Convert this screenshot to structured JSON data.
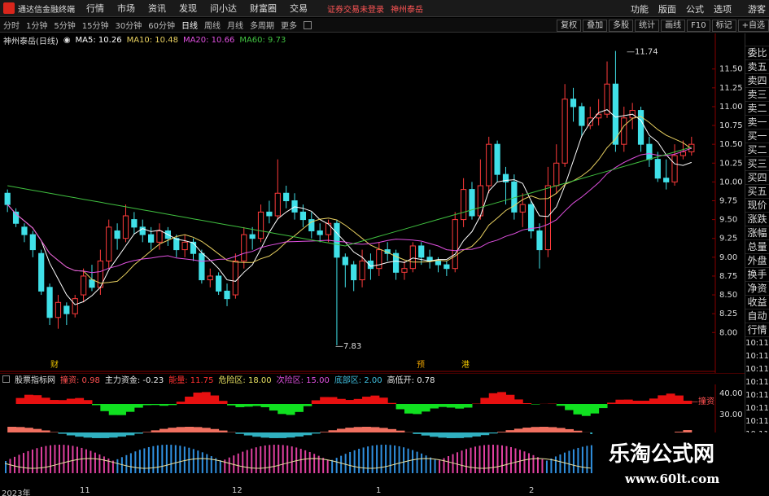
{
  "app": {
    "title": "通达信金融终端",
    "menu": [
      "行情",
      "市场",
      "资讯",
      "发现",
      "问小达",
      "财富圈",
      "交易"
    ],
    "login_notice": "证券交易未登录",
    "stock_name": "神州泰岳",
    "right_menu": [
      "功能",
      "版面",
      "公式",
      "选项"
    ],
    "guest": "游客"
  },
  "periods": [
    "分时",
    "1分钟",
    "5分钟",
    "15分钟",
    "30分钟",
    "60分钟",
    "日线",
    "周线",
    "月线",
    "多周期",
    "更多"
  ],
  "active_period": "日线",
  "toolbar": [
    "复权",
    "叠加",
    "多股",
    "统计",
    "画线",
    "F10",
    "标记",
    "+自选"
  ],
  "ma_legend": {
    "title": "神州泰岳(日线)",
    "ma5": "MA5: 10.26",
    "ma10": "MA10: 10.48",
    "ma20": "MA20: 10.66",
    "ma60": "MA60: 9.73",
    "ma5_color": "#ffffff",
    "ma10_color": "#e8d060",
    "ma20_color": "#e050e0",
    "ma60_color": "#40c040"
  },
  "price_ticks": [
    "11.50",
    "11.25",
    "11.00",
    "10.75",
    "10.50",
    "10.25",
    "10.00",
    "9.75",
    "9.50",
    "9.25",
    "9.00",
    "8.75",
    "8.50",
    "8.25",
    "8.00"
  ],
  "annotations": {
    "high": "11.74",
    "low": "7.83",
    "mark_a": "财",
    "mark_b": "预",
    "mark_c": "港"
  },
  "indicator": {
    "name": "股票指标网",
    "label1": "撞资: 0.98",
    "label2": "主力资金: -0.23",
    "label3": "能量: 11.75",
    "label4": "危险区: 18.00",
    "label5": "次险区: 15.00",
    "label6": "底部区: 2.00",
    "label7": "高低开: 0.78",
    "ticks": [
      "40.00",
      "30.00"
    ],
    "right_label": "撞资"
  },
  "side_panel": {
    "items": [
      "委比",
      "卖五",
      "卖四",
      "卖三",
      "卖二",
      "卖一",
      "买一",
      "买二",
      "买三",
      "买四",
      "买五",
      "现价",
      "涨跌",
      "涨幅",
      "总量",
      "外盘",
      "换手",
      "净资",
      "收益",
      "自动",
      "行情"
    ],
    "times": [
      "10:11",
      "10:11",
      "10:11",
      "10:11",
      "10:11",
      "10:11",
      "10:11",
      "10:11",
      "10:11",
      "10:11"
    ]
  },
  "date_axis": [
    "2023年",
    "11",
    "12",
    "1",
    "2"
  ],
  "watermark": {
    "title": "乐淘公式网",
    "url": "www.60lt.com"
  },
  "chart_data": {
    "type": "candlestick",
    "candles": [
      [
        9.85,
        9.7,
        9.9,
        9.6
      ],
      [
        9.6,
        9.45,
        9.65,
        9.4
      ],
      [
        9.4,
        9.3,
        9.45,
        9.2
      ],
      [
        9.3,
        9.1,
        9.35,
        9.0
      ],
      [
        9.05,
        8.55,
        9.1,
        8.5
      ],
      [
        8.6,
        8.2,
        8.65,
        8.1
      ],
      [
        8.2,
        8.4,
        8.5,
        8.05
      ],
      [
        8.35,
        8.25,
        8.4,
        8.1
      ],
      [
        8.25,
        8.45,
        8.5,
        8.2
      ],
      [
        8.5,
        8.75,
        8.85,
        8.4
      ],
      [
        8.7,
        8.6,
        8.9,
        8.55
      ],
      [
        8.6,
        8.95,
        9.1,
        8.5
      ],
      [
        8.95,
        9.4,
        9.5,
        8.85
      ],
      [
        9.35,
        9.25,
        9.45,
        9.1
      ],
      [
        9.25,
        9.55,
        9.7,
        9.2
      ],
      [
        9.5,
        9.4,
        9.6,
        9.3
      ],
      [
        9.4,
        9.3,
        9.5,
        9.2
      ],
      [
        9.3,
        9.2,
        9.4,
        9.1
      ],
      [
        9.2,
        9.35,
        9.45,
        9.1
      ],
      [
        9.35,
        9.25,
        9.4,
        9.15
      ],
      [
        9.25,
        9.1,
        9.3,
        9.0
      ],
      [
        9.1,
        9.2,
        9.3,
        9.0
      ],
      [
        9.2,
        9.05,
        9.25,
        8.95
      ],
      [
        9.05,
        8.7,
        9.1,
        8.65
      ],
      [
        8.7,
        8.75,
        8.85,
        8.6
      ],
      [
        8.75,
        8.55,
        8.8,
        8.5
      ],
      [
        8.55,
        8.45,
        8.65,
        8.35
      ],
      [
        8.5,
        8.95,
        9.05,
        8.45
      ],
      [
        8.95,
        9.3,
        9.4,
        8.85
      ],
      [
        9.3,
        9.25,
        9.4,
        9.1
      ],
      [
        9.25,
        9.6,
        9.7,
        9.2
      ],
      [
        9.6,
        9.55,
        9.75,
        9.45
      ],
      [
        9.55,
        9.85,
        10.3,
        9.5
      ],
      [
        9.85,
        9.75,
        9.95,
        9.65
      ],
      [
        9.75,
        9.6,
        9.85,
        9.5
      ],
      [
        9.6,
        9.5,
        9.7,
        9.4
      ],
      [
        9.5,
        9.35,
        9.6,
        9.25
      ],
      [
        9.35,
        9.3,
        9.45,
        9.2
      ],
      [
        9.3,
        9.45,
        9.5,
        9.2
      ],
      [
        9.45,
        9.0,
        9.5,
        7.83
      ],
      [
        9.0,
        8.9,
        9.05,
        8.6
      ],
      [
        8.9,
        8.7,
        8.95,
        8.55
      ],
      [
        8.7,
        8.95,
        9.1,
        8.6
      ],
      [
        8.95,
        8.85,
        9.05,
        8.7
      ],
      [
        8.85,
        9.1,
        9.2,
        8.75
      ],
      [
        9.1,
        9.05,
        9.2,
        8.95
      ],
      [
        9.05,
        8.8,
        9.1,
        8.7
      ],
      [
        8.8,
        8.85,
        8.95,
        8.7
      ],
      [
        8.85,
        9.15,
        9.2,
        8.8
      ],
      [
        9.15,
        9.0,
        9.2,
        8.9
      ],
      [
        9.0,
        8.95,
        9.1,
        8.85
      ],
      [
        8.95,
        8.9,
        9.0,
        8.8
      ],
      [
        8.9,
        8.85,
        8.95,
        8.75
      ],
      [
        8.85,
        9.5,
        9.6,
        8.8
      ],
      [
        9.5,
        9.9,
        10.05,
        9.4
      ],
      [
        9.9,
        9.55,
        10.0,
        9.5
      ],
      [
        9.55,
        9.95,
        10.3,
        9.5
      ],
      [
        9.95,
        10.5,
        10.6,
        9.85
      ],
      [
        10.5,
        10.1,
        10.55,
        10.0
      ],
      [
        10.1,
        10.0,
        10.2,
        9.7
      ],
      [
        10.0,
        9.6,
        10.1,
        9.5
      ],
      [
        9.6,
        9.7,
        9.85,
        9.4
      ],
      [
        9.7,
        9.35,
        9.75,
        9.25
      ],
      [
        9.35,
        9.1,
        9.45,
        8.85
      ],
      [
        9.1,
        9.95,
        10.2,
        9.0
      ],
      [
        9.95,
        10.25,
        10.5,
        9.85
      ],
      [
        10.25,
        11.1,
        11.3,
        10.2
      ],
      [
        11.1,
        11.0,
        11.25,
        10.8
      ],
      [
        11.0,
        10.75,
        11.05,
        10.6
      ],
      [
        10.75,
        10.85,
        11.0,
        10.7
      ],
      [
        10.85,
        10.9,
        11.1,
        10.75
      ],
      [
        10.9,
        11.3,
        11.6,
        10.85
      ],
      [
        11.3,
        10.5,
        11.74,
        10.4
      ],
      [
        10.5,
        10.85,
        11.0,
        10.4
      ],
      [
        10.85,
        10.95,
        11.05,
        10.7
      ],
      [
        10.95,
        10.5,
        11.0,
        10.4
      ],
      [
        10.5,
        10.3,
        10.6,
        10.2
      ],
      [
        10.3,
        10.05,
        10.4,
        10.0
      ],
      [
        10.05,
        10.0,
        10.3,
        9.9
      ],
      [
        10.0,
        10.35,
        10.5,
        9.95
      ],
      [
        10.35,
        10.4,
        10.55,
        10.3
      ],
      [
        10.4,
        10.5,
        10.6,
        10.35
      ]
    ],
    "ma_series": [
      "MA5",
      "MA10",
      "MA20",
      "MA60"
    ],
    "ylim": [
      7.7,
      11.8
    ]
  }
}
